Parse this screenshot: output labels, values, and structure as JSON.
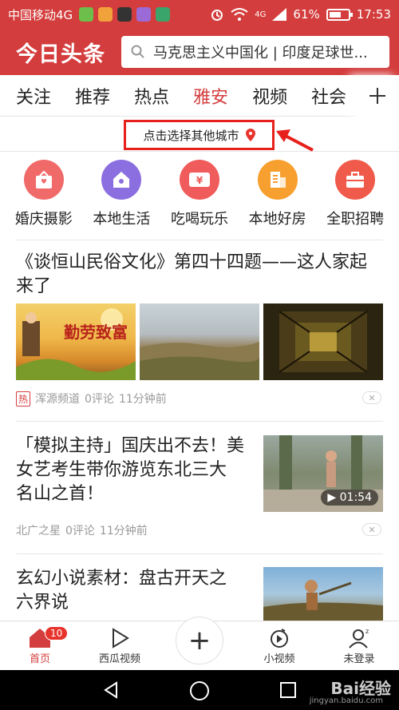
{
  "status_bar": {
    "carrier": "中国移动4G",
    "signal_label": "4G",
    "battery": "61%",
    "time": "17:53"
  },
  "header": {
    "logo": "今日头条",
    "search_text": "马克思主义中国化 | 印度足球世..."
  },
  "tabs": [
    {
      "label": "关注"
    },
    {
      "label": "推荐"
    },
    {
      "label": "热点"
    },
    {
      "label": "雅安"
    },
    {
      "label": "视频"
    },
    {
      "label": "社会"
    }
  ],
  "active_tab": "雅安",
  "city_bar": {
    "label": "点击选择其他城市"
  },
  "categories": [
    {
      "label": "婚庆摄影",
      "color": "#f06a6a"
    },
    {
      "label": "本地生活",
      "color": "#8b6ee0"
    },
    {
      "label": "吃喝玩乐",
      "color": "#f05b5b"
    },
    {
      "label": "本地好房",
      "color": "#f7a030"
    },
    {
      "label": "全职招聘",
      "color": "#f05a4a"
    }
  ],
  "articles": [
    {
      "title_line1": "《谈恒山民俗文化》第四十四题——这人家起",
      "title_line2": "来了",
      "hot": "热",
      "source": "浑源频道",
      "comments": "0评论",
      "time": "11分钟前",
      "thumb_text": "勤劳致富"
    },
    {
      "title_line1": "「模拟主持」国庆出不去！美",
      "title_line2": "女艺考生带你游览东北三大",
      "title_line3": "名山之首！",
      "source": "北广之星",
      "comments": "0评论",
      "time": "11分钟前",
      "duration": "01:54"
    },
    {
      "title_line1": "玄幻小说素材：盘古开天之",
      "title_line2": "六界说"
    }
  ],
  "bottom_nav": {
    "home": "首页",
    "home_badge": "10",
    "xigua": "西瓜视频",
    "publish": "+",
    "small_video": "小视频",
    "login": "未登录"
  },
  "watermark": {
    "brand": "Bai经验",
    "url": "jingyan.baidu.com"
  },
  "colors": {
    "brand_red": "#d43d3d",
    "annotation_red": "#e8201c"
  }
}
